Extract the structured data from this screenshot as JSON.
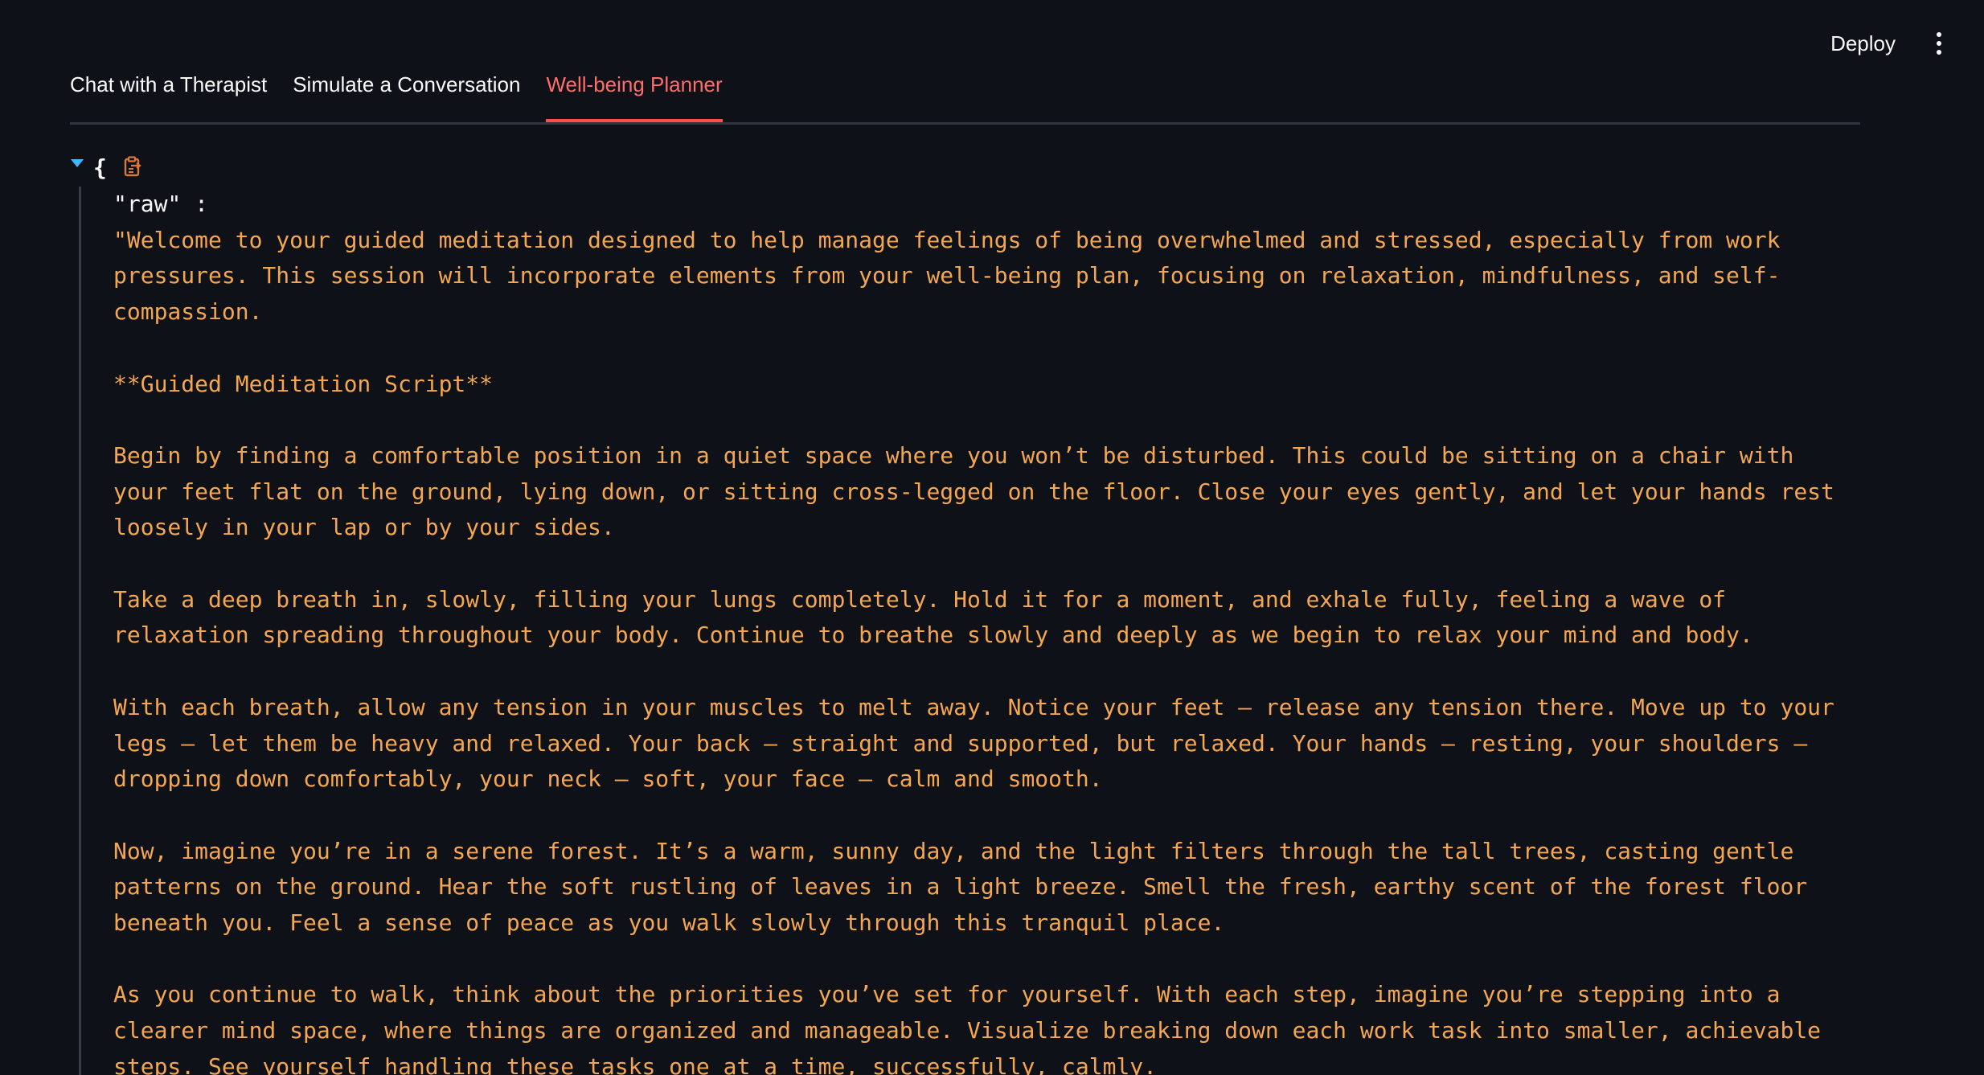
{
  "header": {
    "deploy_label": "Deploy",
    "menu_icon": "kebab-menu-icon"
  },
  "tabs": [
    {
      "label": "Chat with a Therapist",
      "active": false
    },
    {
      "label": "Simulate a Conversation",
      "active": false
    },
    {
      "label": "Well-being Planner",
      "active": true
    }
  ],
  "json_viewer": {
    "open_brace": "{",
    "key": "\"raw\" :",
    "value_lines": [
      "\"Welcome to your guided meditation designed to help manage feelings of being overwhelmed and stressed, especially from work",
      "pressures. This session will incorporate elements from your well-being plan, focusing on relaxation, mindfulness, and self-",
      "compassion.",
      "",
      "**Guided Meditation Script**",
      "",
      "Begin by finding a comfortable position in a quiet space where you won’t be disturbed. This could be sitting on a chair with",
      "your feet flat on the ground, lying down, or sitting cross-legged on the floor. Close your eyes gently, and let your hands rest",
      "loosely in your lap or by your sides.",
      "",
      "Take a deep breath in, slowly, filling your lungs completely. Hold it for a moment, and exhale fully, feeling a wave of",
      "relaxation spreading throughout your body. Continue to breathe slowly and deeply as we begin to relax your mind and body.",
      "",
      "With each breath, allow any tension in your muscles to melt away. Notice your feet – release any tension there. Move up to your",
      "legs – let them be heavy and relaxed. Your back – straight and supported, but relaxed. Your hands – resting, your shoulders –",
      "dropping down comfortably, your neck – soft, your face – calm and smooth.",
      "",
      "Now, imagine you’re in a serene forest. It’s a warm, sunny day, and the light filters through the tall trees, casting gentle",
      "patterns on the ground. Hear the soft rustling of leaves in a light breeze. Smell the fresh, earthy scent of the forest floor",
      "beneath you. Feel a sense of peace as you walk slowly through this tranquil place.",
      "",
      "As you continue to walk, think about the priorities you’ve set for yourself. With each step, imagine you’re stepping into a",
      "clearer mind space, where things are organized and manageable. Visualize breaking down each work task into smaller, achievable",
      "steps. See yourself handling these tasks one at a time, successfully, calmly."
    ]
  },
  "colors": {
    "background": "#0e1117",
    "active_tab": "#ff6c6c",
    "tab_underline": "#ff4b4b",
    "string_value": "#f5a650",
    "caret": "#3fb6ff"
  }
}
